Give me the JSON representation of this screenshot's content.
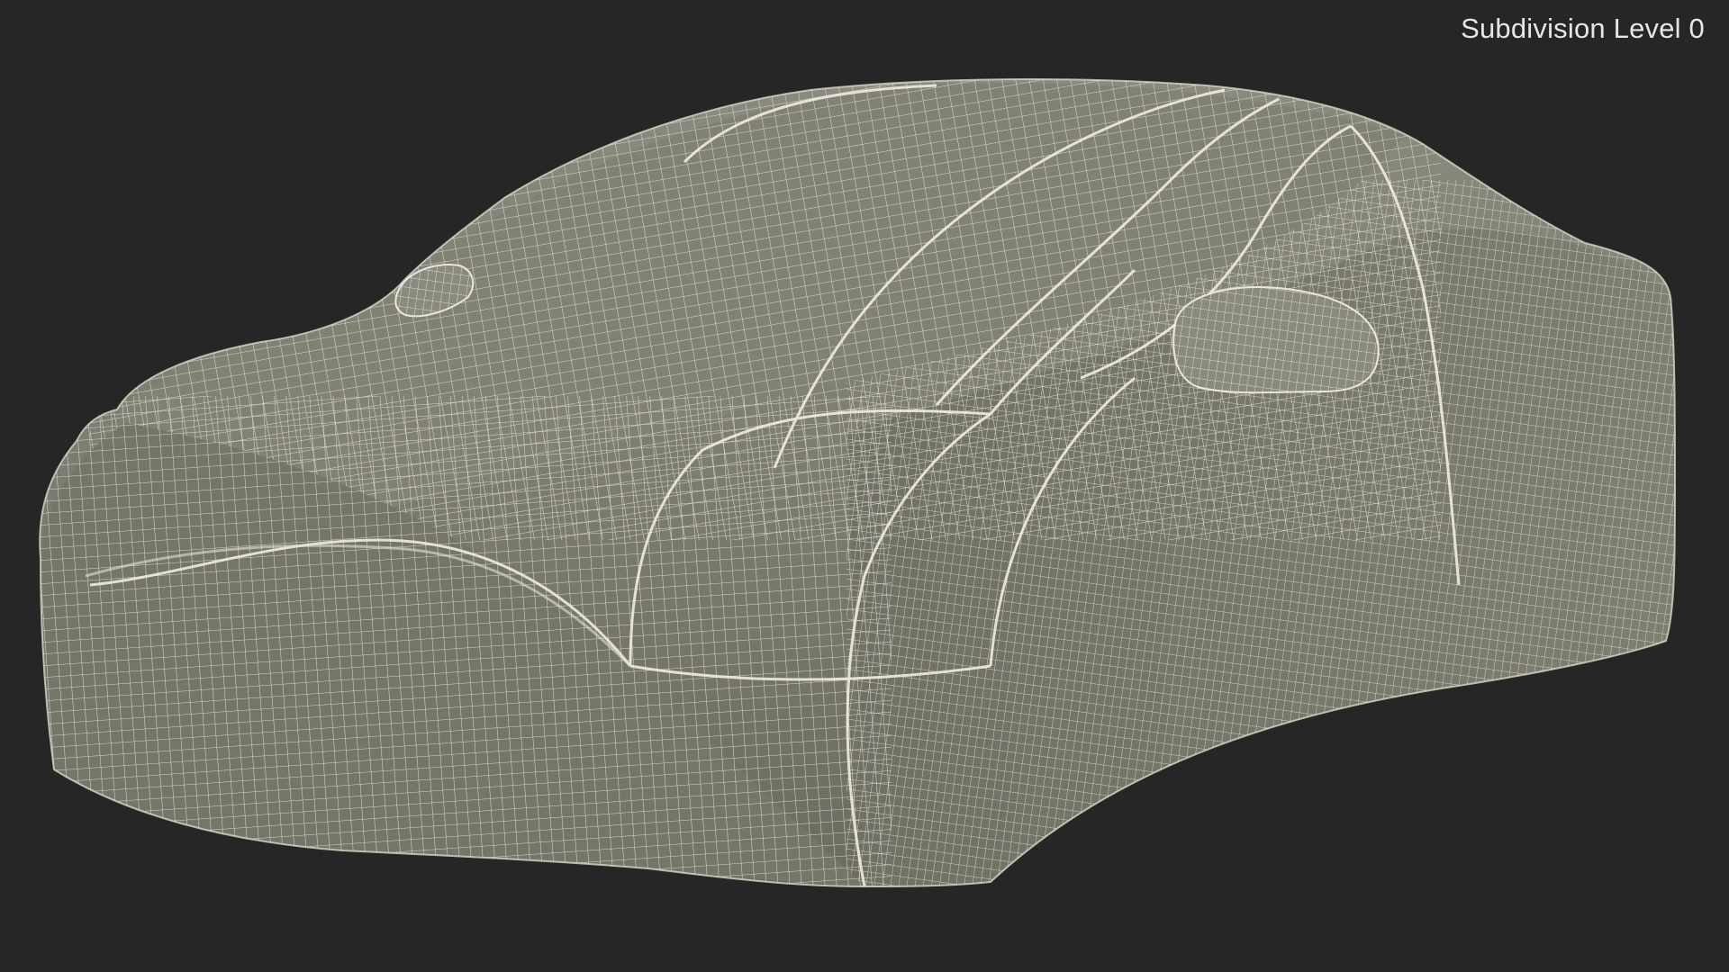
{
  "viewport": {
    "label": "Subdivision Level 0",
    "background_color": "#262626",
    "mesh_fill_color": "#7a7a6e",
    "wire_color": "#e9e8d8",
    "subject": "car-cover-wireframe"
  }
}
